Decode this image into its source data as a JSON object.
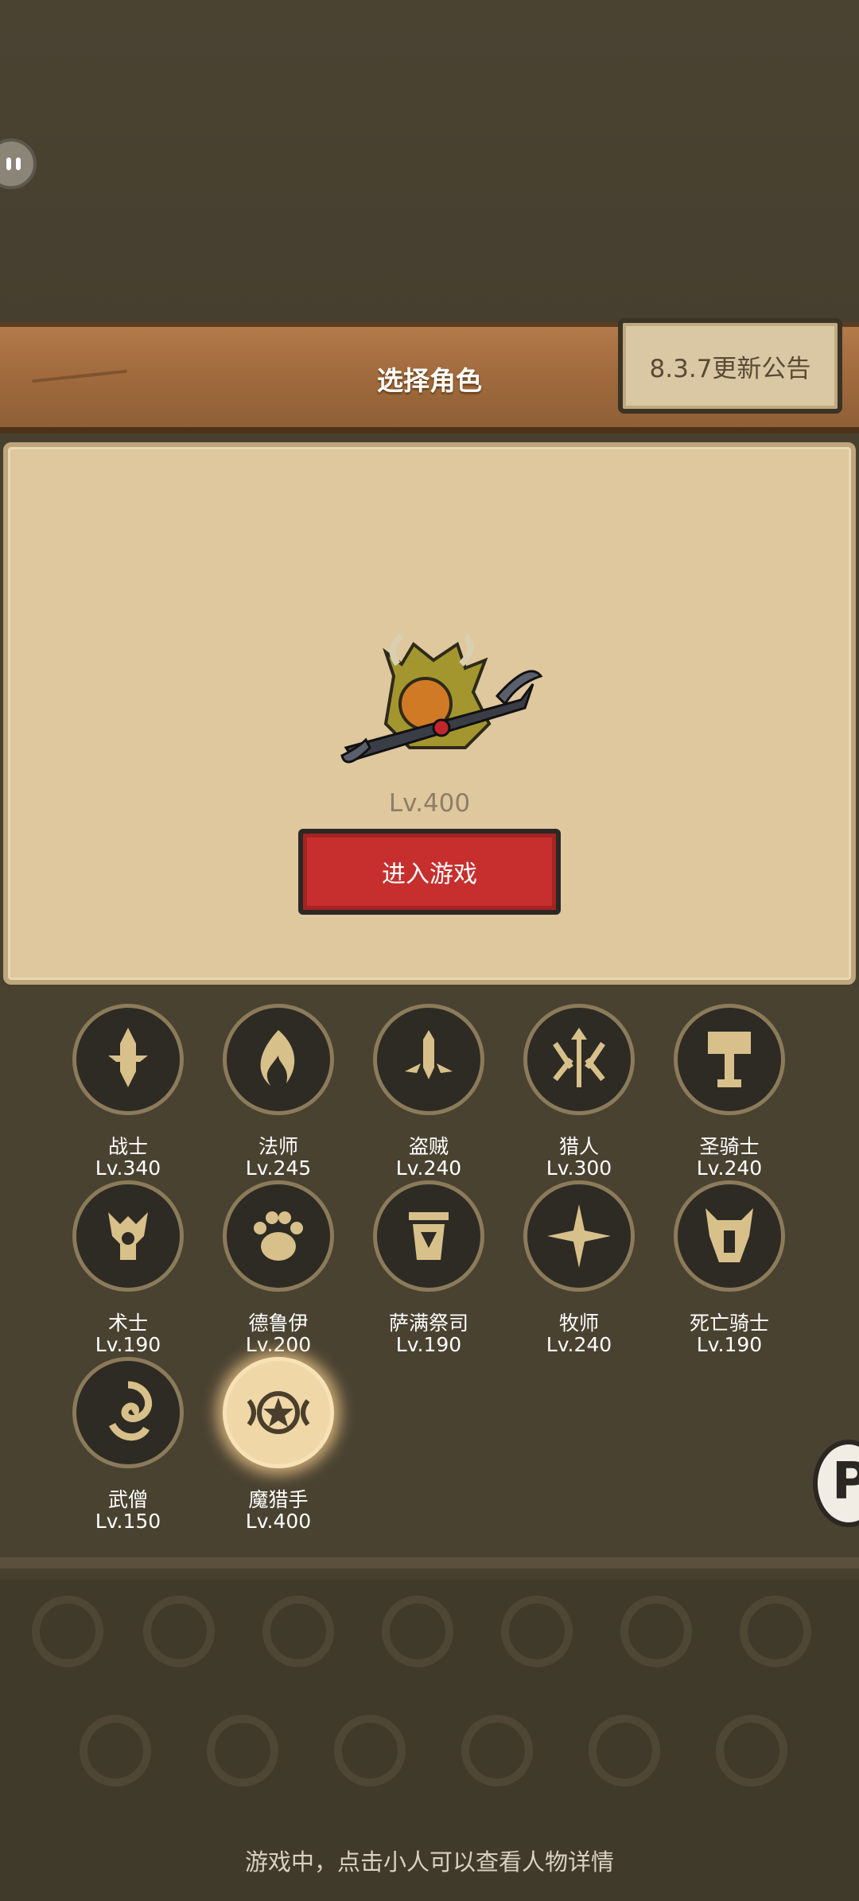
{
  "header": {
    "title": "选择角色",
    "notice_label": "8.3.7更新公告"
  },
  "current_character": {
    "level": "Lv.400",
    "enter_label": "进入游戏"
  },
  "classes": [
    {
      "name": "战士",
      "level": "Lv.340",
      "icon": "sword-icon"
    },
    {
      "name": "法师",
      "level": "Lv.245",
      "icon": "flame-icon"
    },
    {
      "name": "盗贼",
      "level": "Lv.240",
      "icon": "dagger-icon"
    },
    {
      "name": "猎人",
      "level": "Lv.300",
      "icon": "arrows-icon"
    },
    {
      "name": "圣骑士",
      "level": "Lv.240",
      "icon": "hammer-icon"
    },
    {
      "name": "术士",
      "level": "Lv.190",
      "icon": "demon-skull-icon"
    },
    {
      "name": "德鲁伊",
      "level": "Lv.200",
      "icon": "paw-icon"
    },
    {
      "name": "萨满祭司",
      "level": "Lv.190",
      "icon": "totem-icon"
    },
    {
      "name": "牧师",
      "level": "Lv.240",
      "icon": "star-burst-icon"
    },
    {
      "name": "死亡骑士",
      "level": "Lv.190",
      "icon": "helmet-icon"
    },
    {
      "name": "武僧",
      "level": "Lv.150",
      "icon": "swirl-icon"
    },
    {
      "name": "魔猎手",
      "level": "Lv.400",
      "icon": "pentagram-icon",
      "selected": true
    }
  ],
  "footer": {
    "hint": "游戏中，点击小人可以查看人物详情"
  },
  "colors": {
    "background": "#47402f",
    "header_wood": "#a06a3d",
    "panel_parchment": "#dfc79e",
    "enter_button": "#c62f2d",
    "badge_ring": "#8b7b5a",
    "selected_glow": "#f0d7a8"
  }
}
